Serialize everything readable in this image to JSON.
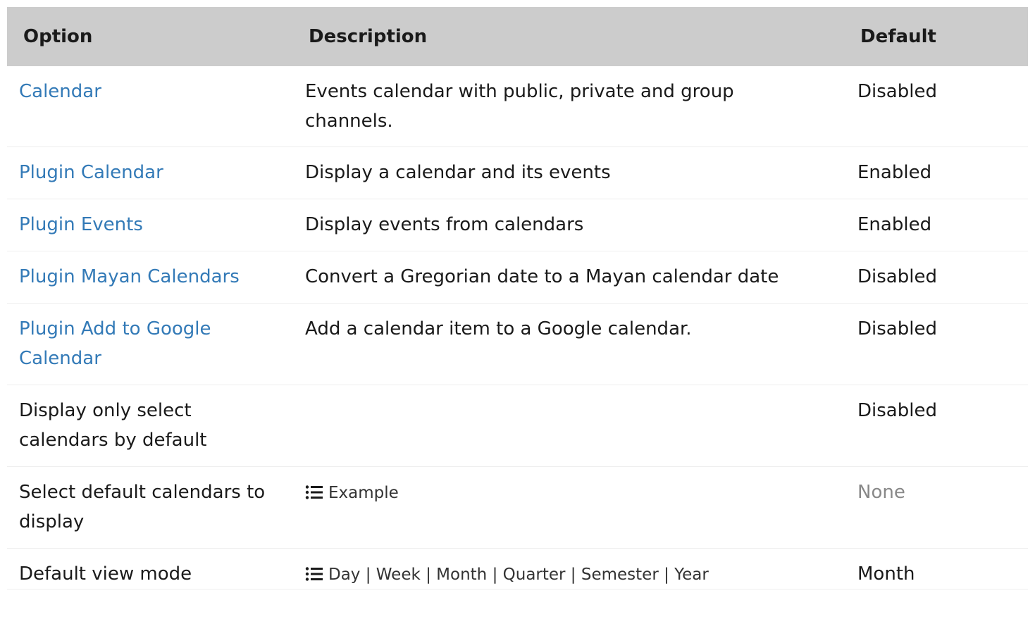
{
  "headers": {
    "option": "Option",
    "description": "Description",
    "default": "Default"
  },
  "rows": [
    {
      "option": "Calendar",
      "description": "Events calendar with public, private and group channels.",
      "default": "Disabled"
    },
    {
      "option": "Plugin Calendar",
      "description": "Display a calendar and its events",
      "default": "Enabled"
    },
    {
      "option": "Plugin Events",
      "description": "Display events from calendars",
      "default": "Enabled"
    },
    {
      "option": "Plugin Mayan Calendars",
      "description": "Convert a Gregorian date to a Mayan calendar date",
      "default": "Disabled"
    },
    {
      "option": "Plugin Add to Google Calendar",
      "description": "Add a calendar item to a Google calendar.",
      "default": "Disabled"
    },
    {
      "option": "Display only select calendars by default",
      "description": "",
      "default": "Disabled"
    },
    {
      "option": "Select default calendars to display",
      "description": "Example",
      "default": "None"
    },
    {
      "option": "Default view mode",
      "description": "Day | Week | Month | Quarter | Semester | Year",
      "default": "Month"
    }
  ],
  "icons": {
    "list": "list-icon"
  },
  "colors": {
    "header_bg": "#cccccc",
    "link": "#337ab7",
    "muted": "#888888"
  }
}
